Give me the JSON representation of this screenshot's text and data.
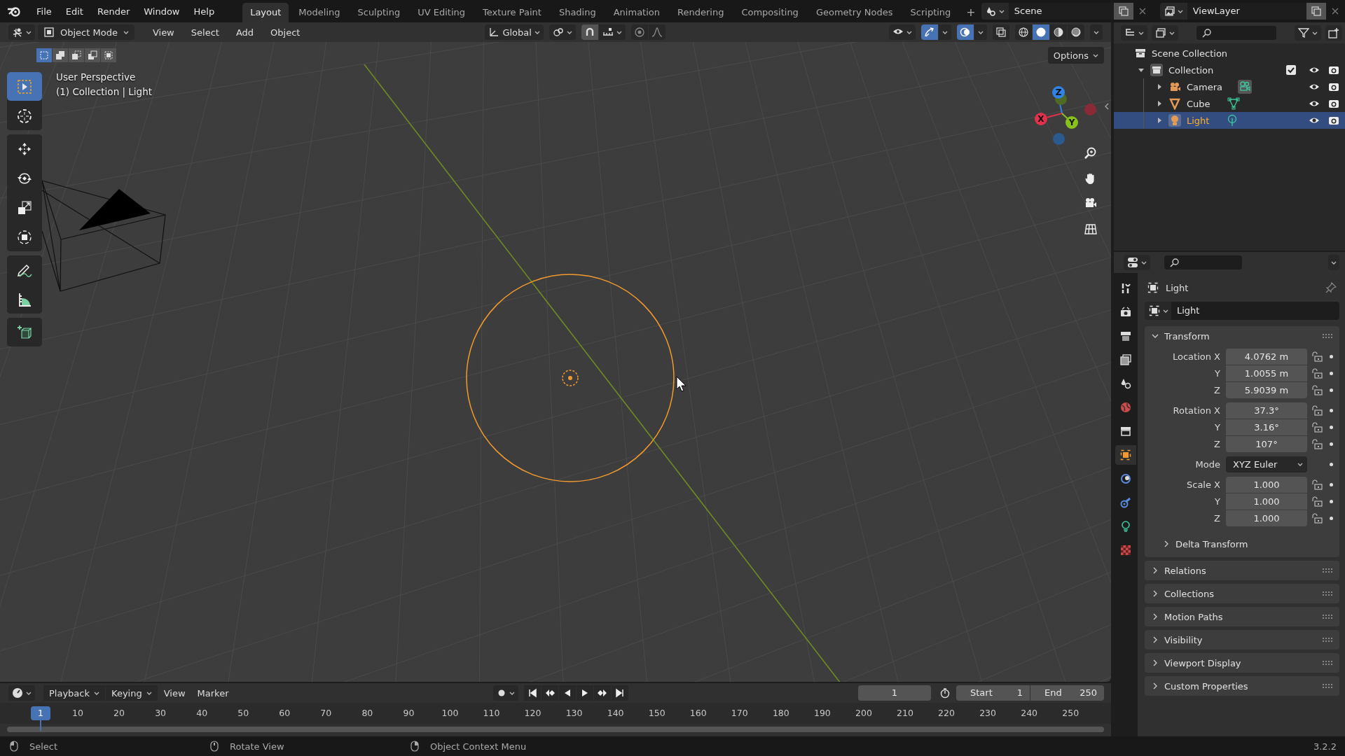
{
  "top_bar": {
    "menus": [
      "File",
      "Edit",
      "Render",
      "Window",
      "Help"
    ],
    "workspaces": [
      {
        "label": "Layout",
        "selected": true
      },
      {
        "label": "Modeling",
        "selected": false
      },
      {
        "label": "Sculpting",
        "selected": false
      },
      {
        "label": "UV Editing",
        "selected": false
      },
      {
        "label": "Texture Paint",
        "selected": false
      },
      {
        "label": "Shading",
        "selected": false
      },
      {
        "label": "Animation",
        "selected": false
      },
      {
        "label": "Rendering",
        "selected": false
      },
      {
        "label": "Compositing",
        "selected": false
      },
      {
        "label": "Geometry Nodes",
        "selected": false
      },
      {
        "label": "Scripting",
        "selected": false
      }
    ],
    "add_workspace": "+",
    "scene": "Scene",
    "view_layer": "ViewLayer"
  },
  "viewport": {
    "mode": "Object Mode",
    "menus": [
      "View",
      "Select",
      "Add",
      "Object"
    ],
    "orientation": "Global",
    "options": "Options",
    "gizmos_on": true,
    "overlays_on": true,
    "xray_on": false,
    "shading": [
      {
        "kind": "wireframe",
        "selected": false
      },
      {
        "kind": "solid",
        "selected": true
      },
      {
        "kind": "material",
        "selected": false
      },
      {
        "kind": "rendered",
        "selected": false
      }
    ],
    "select_modes": [
      {
        "kind": "new",
        "selected": true
      },
      {
        "kind": "extend",
        "selected": false
      },
      {
        "kind": "subtract",
        "selected": false
      },
      {
        "kind": "invert",
        "selected": false
      },
      {
        "kind": "intersect",
        "selected": false
      }
    ],
    "overlay_text": [
      "User Perspective",
      "(1) Collection | Light"
    ],
    "tool_groups": [
      [
        {
          "kind": "select",
          "selected": true
        },
        {
          "kind": "cursor",
          "selected": false
        }
      ],
      [
        {
          "kind": "move",
          "selected": false
        },
        {
          "kind": "rotate",
          "selected": false
        },
        {
          "kind": "scale",
          "selected": false
        },
        {
          "kind": "transform",
          "selected": false
        }
      ],
      [
        {
          "kind": "annotate",
          "selected": false
        },
        {
          "kind": "measure",
          "selected": false
        }
      ],
      [
        {
          "kind": "add-cube",
          "selected": false
        }
      ]
    ],
    "axes": [
      {
        "label": "Z",
        "color": "#2f83e3"
      },
      {
        "label": "X",
        "color": "#e2324b"
      },
      {
        "label": "Y",
        "color": "#89c11c"
      }
    ]
  },
  "outliner": {
    "root": "Scene Collection",
    "collections": [
      {
        "name": "Collection",
        "checked": true,
        "expanded": true,
        "children": [
          {
            "name": "Camera",
            "kind": "camera",
            "selected": false
          },
          {
            "name": "Cube",
            "kind": "mesh",
            "selected": false
          },
          {
            "name": "Light",
            "kind": "light",
            "selected": true
          }
        ]
      }
    ]
  },
  "properties": {
    "tabs": [
      {
        "kind": "tool",
        "selected": false
      },
      {
        "kind": "render",
        "selected": false
      },
      {
        "kind": "output",
        "selected": false
      },
      {
        "kind": "view-layer",
        "selected": false
      },
      {
        "kind": "scene",
        "selected": false
      },
      {
        "kind": "world",
        "selected": false
      },
      {
        "kind": "collection",
        "selected": false
      },
      {
        "kind": "object",
        "selected": true
      },
      {
        "kind": "physics",
        "selected": false
      },
      {
        "kind": "constraints",
        "selected": false
      },
      {
        "kind": "data",
        "selected": false
      },
      {
        "kind": "texture",
        "selected": false
      }
    ],
    "context": "Light",
    "object_name": "Light",
    "transform": {
      "title": "Transform",
      "expanded": true,
      "groups": [
        {
          "kind": "fields",
          "rows": [
            {
              "label": "Location X",
              "value": "4.0762 m"
            },
            {
              "label": "Y",
              "value": "1.0055 m"
            },
            {
              "label": "Z",
              "value": "5.9039 m"
            }
          ]
        },
        {
          "kind": "fields",
          "rows": [
            {
              "label": "Rotation X",
              "value": "37.3°"
            },
            {
              "label": "Y",
              "value": "3.16°"
            },
            {
              "label": "Z",
              "value": "107°"
            }
          ]
        },
        {
          "kind": "dropdown",
          "rows": [
            {
              "label": "Mode",
              "value": "XYZ Euler"
            }
          ]
        },
        {
          "kind": "fields",
          "rows": [
            {
              "label": "Scale X",
              "value": "1.000"
            },
            {
              "label": "Y",
              "value": "1.000"
            },
            {
              "label": "Z",
              "value": "1.000"
            }
          ]
        }
      ],
      "subpanel": {
        "title": "Delta Transform",
        "expanded": false
      }
    },
    "panels": [
      {
        "title": "Relations",
        "expanded": false
      },
      {
        "title": "Collections",
        "expanded": false
      },
      {
        "title": "Motion Paths",
        "expanded": false
      },
      {
        "title": "Visibility",
        "expanded": false
      },
      {
        "title": "Viewport Display",
        "expanded": false
      },
      {
        "title": "Custom Properties",
        "expanded": false
      }
    ]
  },
  "timeline": {
    "auto_keying_on": false,
    "menus": [
      {
        "label": "Playback",
        "dropdown": true
      },
      {
        "label": "Keying",
        "dropdown": true
      },
      {
        "label": "View",
        "dropdown": false
      },
      {
        "label": "Marker",
        "dropdown": false
      }
    ],
    "current_frame": "1",
    "start_label": "Start",
    "start": "1",
    "end_label": "End",
    "end": "250",
    "playhead": "1",
    "ticks": [
      "10",
      "20",
      "30",
      "40",
      "50",
      "60",
      "70",
      "80",
      "90",
      "100",
      "110",
      "120",
      "130",
      "140",
      "150",
      "160",
      "170",
      "180",
      "190",
      "200",
      "210",
      "220",
      "230",
      "240",
      "250"
    ]
  },
  "status_bar": {
    "hints": [
      {
        "kind": "left-click",
        "label": "Select"
      },
      {
        "kind": "middle-click",
        "label": "Rotate View"
      },
      {
        "kind": "right-click",
        "label": "Object Context Menu"
      }
    ],
    "version": "3.2.2"
  }
}
